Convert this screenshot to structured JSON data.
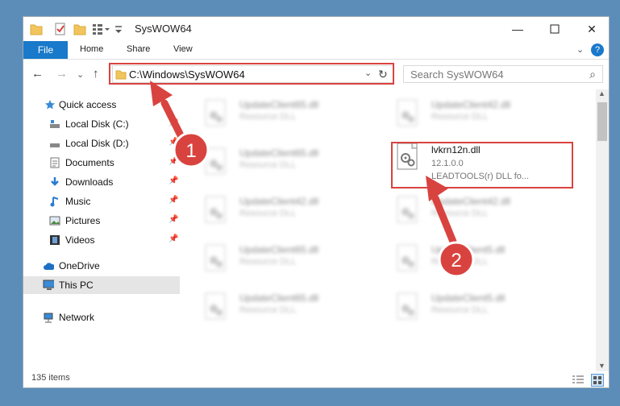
{
  "window": {
    "title": "SysWOW64"
  },
  "ribbon": {
    "file": "File",
    "tabs": [
      "Home",
      "Share",
      "View"
    ],
    "help": "?"
  },
  "address": {
    "path": "C:\\Windows\\SysWOW64"
  },
  "search": {
    "placeholder": "Search SysWOW64"
  },
  "sidebar": {
    "items": [
      {
        "label": "Quick access"
      },
      {
        "label": "Local Disk (C:)"
      },
      {
        "label": "Local Disk (D:)"
      },
      {
        "label": "Documents"
      },
      {
        "label": "Downloads"
      },
      {
        "label": "Music"
      },
      {
        "label": "Pictures"
      },
      {
        "label": "Videos"
      },
      {
        "label": "OneDrive"
      },
      {
        "label": "This PC"
      },
      {
        "label": "Network"
      }
    ]
  },
  "files": {
    "col1": [
      {
        "name": "UpdateClient65.dll",
        "sub": "Resource DLL"
      },
      {
        "name": "UpdateClient65.dll",
        "sub": "Resource DLL"
      },
      {
        "name": "UpdateClient42.dll",
        "sub": "Resource DLL"
      },
      {
        "name": "UpdateClient65.dll",
        "sub": "Resource DLL"
      },
      {
        "name": "UpdateClient65.dll",
        "sub": "Resource DLL"
      }
    ],
    "col2": [
      {
        "name": "UpdateClient42.dll",
        "sub": "Resource DLL"
      },
      {
        "name": "UpdateClient42.dll",
        "sub": "Resource DLL"
      },
      {
        "name": "UpdateClient5.dll",
        "sub": "Resource DLL"
      },
      {
        "name": "UpdateClient5.dll",
        "sub": "Resource DLL"
      }
    ],
    "highlight": {
      "name": "lvkrn12n.dll",
      "version": "12.1.0.0",
      "desc": "LEADTOOLS(r) DLL fo..."
    }
  },
  "status": {
    "count": "135 items"
  },
  "annotations": {
    "step1": "1",
    "step2": "2"
  },
  "colors": {
    "highlight": "#d9433f",
    "accent": "#1979ca"
  }
}
